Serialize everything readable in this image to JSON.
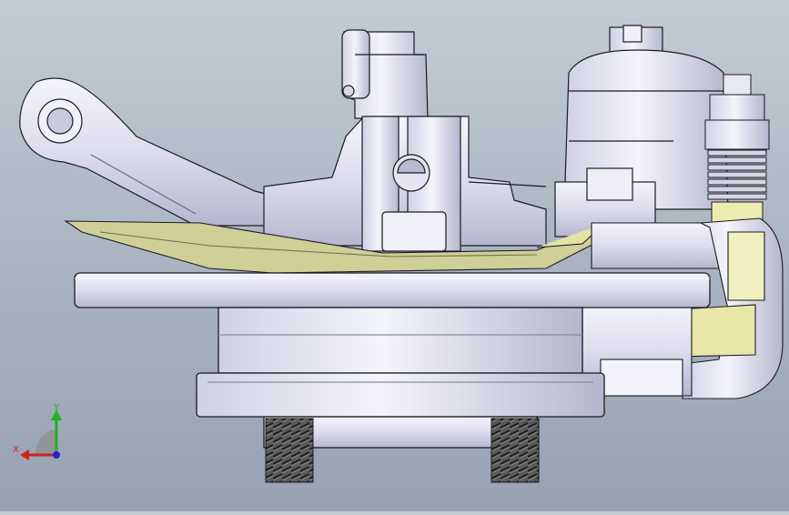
{
  "viewport": {
    "background_top": "#c4cbd6",
    "background_bottom": "#98a2b2"
  },
  "model": {
    "part_fill": "#e8e8f4",
    "part_shade": "#b8b9d0",
    "part_stroke": "#1b1b22",
    "gasket_fill": "#c8c88a",
    "yellow_fill": "#e8e6a8",
    "thread_fill": "#4a4a4a"
  },
  "triad": {
    "x_label": "X",
    "y_label": "Y",
    "x_color": "#d42020",
    "y_color": "#20b020",
    "z_color": "#2020d0"
  }
}
